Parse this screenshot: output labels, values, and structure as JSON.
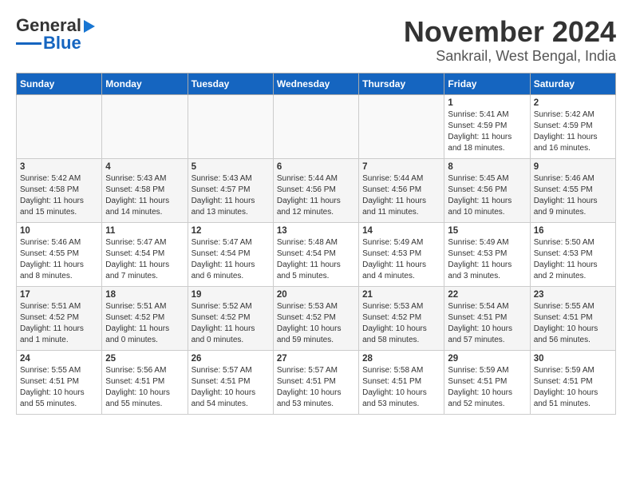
{
  "logo": {
    "line1": "General",
    "line2": "Blue"
  },
  "title": "November 2024",
  "subtitle": "Sankrail, West Bengal, India",
  "headers": [
    "Sunday",
    "Monday",
    "Tuesday",
    "Wednesday",
    "Thursday",
    "Friday",
    "Saturday"
  ],
  "weeks": [
    [
      {
        "day": "",
        "info": ""
      },
      {
        "day": "",
        "info": ""
      },
      {
        "day": "",
        "info": ""
      },
      {
        "day": "",
        "info": ""
      },
      {
        "day": "",
        "info": ""
      },
      {
        "day": "1",
        "info": "Sunrise: 5:41 AM\nSunset: 4:59 PM\nDaylight: 11 hours and 18 minutes."
      },
      {
        "day": "2",
        "info": "Sunrise: 5:42 AM\nSunset: 4:59 PM\nDaylight: 11 hours and 16 minutes."
      }
    ],
    [
      {
        "day": "3",
        "info": "Sunrise: 5:42 AM\nSunset: 4:58 PM\nDaylight: 11 hours and 15 minutes."
      },
      {
        "day": "4",
        "info": "Sunrise: 5:43 AM\nSunset: 4:58 PM\nDaylight: 11 hours and 14 minutes."
      },
      {
        "day": "5",
        "info": "Sunrise: 5:43 AM\nSunset: 4:57 PM\nDaylight: 11 hours and 13 minutes."
      },
      {
        "day": "6",
        "info": "Sunrise: 5:44 AM\nSunset: 4:56 PM\nDaylight: 11 hours and 12 minutes."
      },
      {
        "day": "7",
        "info": "Sunrise: 5:44 AM\nSunset: 4:56 PM\nDaylight: 11 hours and 11 minutes."
      },
      {
        "day": "8",
        "info": "Sunrise: 5:45 AM\nSunset: 4:56 PM\nDaylight: 11 hours and 10 minutes."
      },
      {
        "day": "9",
        "info": "Sunrise: 5:46 AM\nSunset: 4:55 PM\nDaylight: 11 hours and 9 minutes."
      }
    ],
    [
      {
        "day": "10",
        "info": "Sunrise: 5:46 AM\nSunset: 4:55 PM\nDaylight: 11 hours and 8 minutes."
      },
      {
        "day": "11",
        "info": "Sunrise: 5:47 AM\nSunset: 4:54 PM\nDaylight: 11 hours and 7 minutes."
      },
      {
        "day": "12",
        "info": "Sunrise: 5:47 AM\nSunset: 4:54 PM\nDaylight: 11 hours and 6 minutes."
      },
      {
        "day": "13",
        "info": "Sunrise: 5:48 AM\nSunset: 4:54 PM\nDaylight: 11 hours and 5 minutes."
      },
      {
        "day": "14",
        "info": "Sunrise: 5:49 AM\nSunset: 4:53 PM\nDaylight: 11 hours and 4 minutes."
      },
      {
        "day": "15",
        "info": "Sunrise: 5:49 AM\nSunset: 4:53 PM\nDaylight: 11 hours and 3 minutes."
      },
      {
        "day": "16",
        "info": "Sunrise: 5:50 AM\nSunset: 4:53 PM\nDaylight: 11 hours and 2 minutes."
      }
    ],
    [
      {
        "day": "17",
        "info": "Sunrise: 5:51 AM\nSunset: 4:52 PM\nDaylight: 11 hours and 1 minute."
      },
      {
        "day": "18",
        "info": "Sunrise: 5:51 AM\nSunset: 4:52 PM\nDaylight: 11 hours and 0 minutes."
      },
      {
        "day": "19",
        "info": "Sunrise: 5:52 AM\nSunset: 4:52 PM\nDaylight: 11 hours and 0 minutes."
      },
      {
        "day": "20",
        "info": "Sunrise: 5:53 AM\nSunset: 4:52 PM\nDaylight: 10 hours and 59 minutes."
      },
      {
        "day": "21",
        "info": "Sunrise: 5:53 AM\nSunset: 4:52 PM\nDaylight: 10 hours and 58 minutes."
      },
      {
        "day": "22",
        "info": "Sunrise: 5:54 AM\nSunset: 4:51 PM\nDaylight: 10 hours and 57 minutes."
      },
      {
        "day": "23",
        "info": "Sunrise: 5:55 AM\nSunset: 4:51 PM\nDaylight: 10 hours and 56 minutes."
      }
    ],
    [
      {
        "day": "24",
        "info": "Sunrise: 5:55 AM\nSunset: 4:51 PM\nDaylight: 10 hours and 55 minutes."
      },
      {
        "day": "25",
        "info": "Sunrise: 5:56 AM\nSunset: 4:51 PM\nDaylight: 10 hours and 55 minutes."
      },
      {
        "day": "26",
        "info": "Sunrise: 5:57 AM\nSunset: 4:51 PM\nDaylight: 10 hours and 54 minutes."
      },
      {
        "day": "27",
        "info": "Sunrise: 5:57 AM\nSunset: 4:51 PM\nDaylight: 10 hours and 53 minutes."
      },
      {
        "day": "28",
        "info": "Sunrise: 5:58 AM\nSunset: 4:51 PM\nDaylight: 10 hours and 53 minutes."
      },
      {
        "day": "29",
        "info": "Sunrise: 5:59 AM\nSunset: 4:51 PM\nDaylight: 10 hours and 52 minutes."
      },
      {
        "day": "30",
        "info": "Sunrise: 5:59 AM\nSunset: 4:51 PM\nDaylight: 10 hours and 51 minutes."
      }
    ]
  ]
}
